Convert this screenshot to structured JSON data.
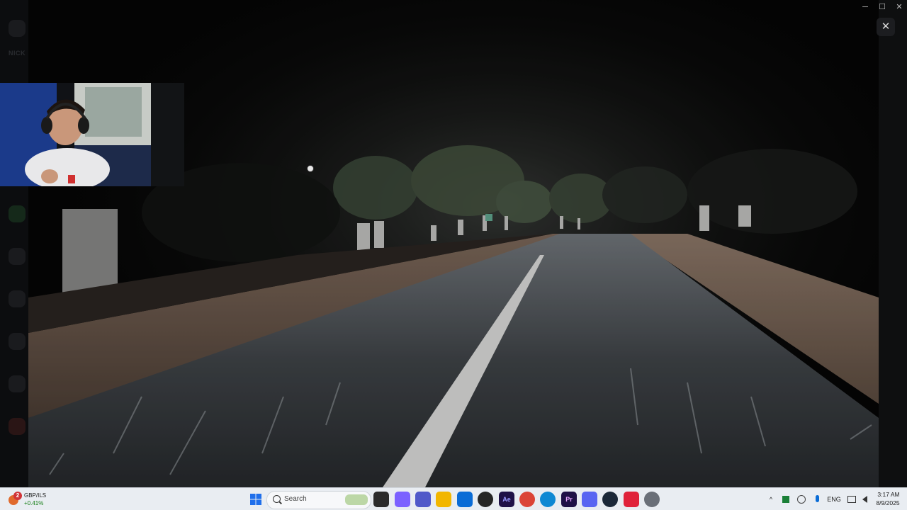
{
  "window": {
    "close_glyph": "✕",
    "minimize_glyph": "─",
    "maximize_glyph": "☐"
  },
  "background_app": {
    "rail_label": "NICK"
  },
  "viewer": {
    "content": "night-road-driving-video"
  },
  "taskbar": {
    "widget": {
      "badge": "2",
      "title": "GBP/ILS",
      "value": "+0.41%"
    },
    "search": {
      "placeholder": "Search"
    },
    "apps": [
      {
        "name": "start",
        "color": "#1f6feb"
      },
      {
        "name": "task-view",
        "color": "#2b2b2b"
      },
      {
        "name": "copilot",
        "color": "#7b61ff"
      },
      {
        "name": "teams",
        "color": "#5059c9"
      },
      {
        "name": "file-explorer",
        "color": "#f2b600"
      },
      {
        "name": "store",
        "color": "#0a6cd6"
      },
      {
        "name": "obs",
        "color": "#262626"
      },
      {
        "name": "after-effects",
        "glyph": "Ae",
        "color": "#1f1147"
      },
      {
        "name": "chrome",
        "color": "#db4437"
      },
      {
        "name": "edge",
        "color": "#0e88d3"
      },
      {
        "name": "premiere",
        "glyph": "Pr",
        "color": "#1f1147"
      },
      {
        "name": "discord",
        "color": "#5865f2"
      },
      {
        "name": "steam",
        "color": "#1b2838"
      },
      {
        "name": "app-red",
        "color": "#e0223a"
      },
      {
        "name": "settings",
        "color": "#6a6f78"
      }
    ],
    "tray": {
      "chevron": "^",
      "language": "ENG",
      "time": "3:17 AM",
      "date": "8/9/2025"
    }
  }
}
